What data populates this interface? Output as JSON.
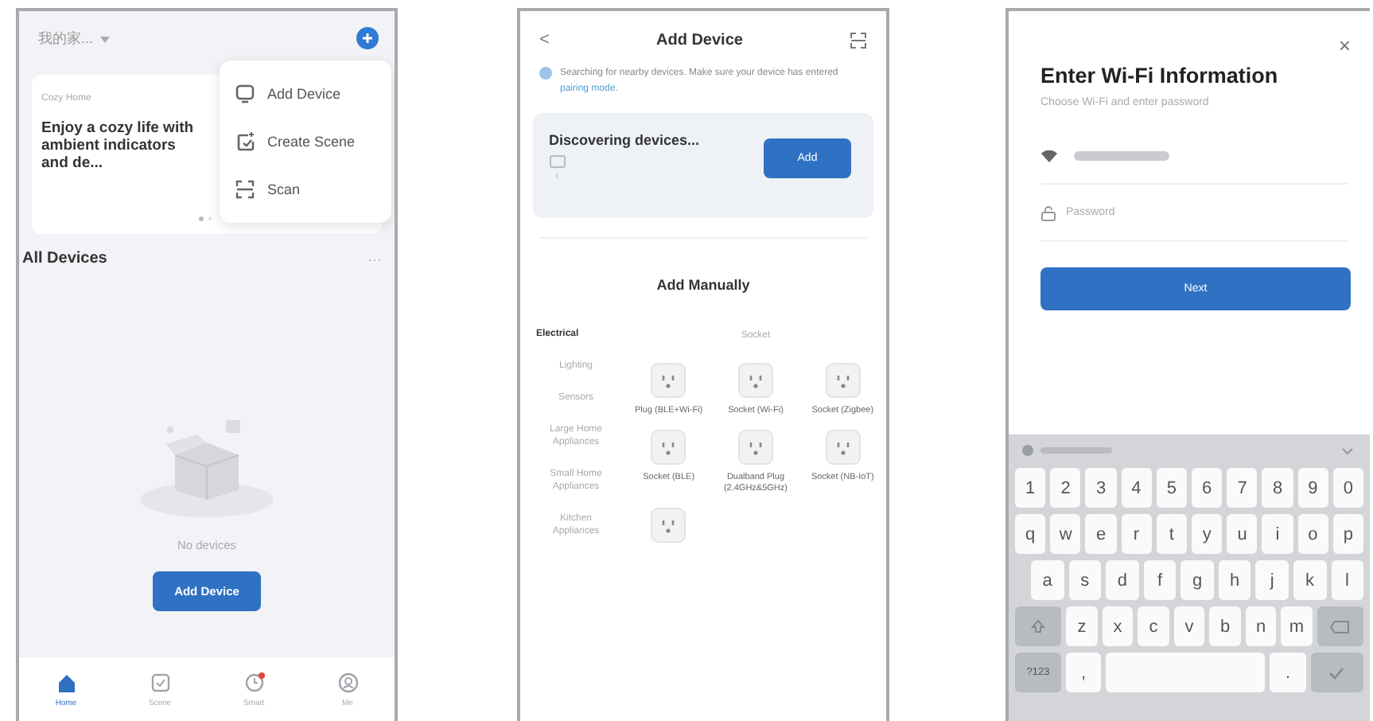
{
  "home_screen": {
    "home_name": "我的家...",
    "card": {
      "label": "Cozy Home",
      "text": "Enjoy a cozy life with ambient indicators and de..."
    },
    "menu": [
      {
        "kind": "add",
        "label": "Add Device"
      },
      {
        "kind": "scene",
        "label": "Create Scene"
      },
      {
        "kind": "scan",
        "label": "Scan"
      }
    ],
    "section_title": "All Devices",
    "more": "···",
    "empty_text": "No devices",
    "add_button": "Add Device",
    "tabs": [
      {
        "kind": "home",
        "label": "Home",
        "selected": true,
        "badge": false
      },
      {
        "kind": "scene",
        "label": "Scene",
        "selected": false,
        "badge": false
      },
      {
        "kind": "smart",
        "label": "Smart",
        "selected": false,
        "badge": true
      },
      {
        "kind": "me",
        "label": "Me",
        "selected": false,
        "badge": false
      }
    ]
  },
  "add_device_screen": {
    "back": "<",
    "title": "Add Device",
    "notice": "Searching for nearby devices. Make sure your device has entered ",
    "notice_link": "pairing mode",
    "notice_end": ".",
    "discovering": "Discovering devices...",
    "add_button": "Add",
    "section_title": "Add Manually",
    "categories": [
      {
        "label": "Electrical",
        "selected": true
      },
      {
        "label": "Lighting",
        "selected": false
      },
      {
        "label": "Sensors",
        "selected": false
      },
      {
        "label": "Large Home Appliances",
        "selected": false
      },
      {
        "label": "Small Home Appliances",
        "selected": false
      },
      {
        "label": "Kitchen Appliances",
        "selected": false
      }
    ],
    "group_title": "Socket",
    "devices": [
      {
        "kind": "socket",
        "name": "Plug (BLE+Wi-Fi)"
      },
      {
        "kind": "socket",
        "name": "Socket (Wi-Fi)"
      },
      {
        "kind": "socket",
        "name": "Socket (Zigbee)"
      },
      {
        "kind": "socket",
        "name": "Socket (BLE)"
      },
      {
        "kind": "socket",
        "name": "Dualband Plug (2.4GHz&5GHz)"
      },
      {
        "kind": "socket",
        "name": "Socket (NB-IoT)"
      },
      {
        "kind": "socket"
      }
    ]
  },
  "wifi_screen": {
    "close": "×",
    "title": "Enter Wi-Fi Information",
    "subtitle": "Choose Wi-Fi and enter password",
    "password_placeholder": "Password",
    "next_button": "Next",
    "keyboard": [
      [
        {
          "kind": "char",
          "label": "1"
        },
        {
          "kind": "char",
          "label": "2"
        },
        {
          "kind": "char",
          "label": "3"
        },
        {
          "kind": "char",
          "label": "4"
        },
        {
          "kind": "char",
          "label": "5"
        },
        {
          "kind": "char",
          "label": "6"
        },
        {
          "kind": "char",
          "label": "7"
        },
        {
          "kind": "char",
          "label": "8"
        },
        {
          "kind": "char",
          "label": "9"
        },
        {
          "kind": "char",
          "label": "0"
        }
      ],
      [
        {
          "kind": "char",
          "label": "q"
        },
        {
          "kind": "char",
          "label": "w"
        },
        {
          "kind": "char",
          "label": "e"
        },
        {
          "kind": "char",
          "label": "r"
        },
        {
          "kind": "char",
          "label": "t"
        },
        {
          "kind": "char",
          "label": "y"
        },
        {
          "kind": "char",
          "label": "u"
        },
        {
          "kind": "char",
          "label": "i"
        },
        {
          "kind": "char",
          "label": "o"
        },
        {
          "kind": "char",
          "label": "p"
        }
      ],
      [
        {
          "kind": "char",
          "label": "a"
        },
        {
          "kind": "char",
          "label": "s"
        },
        {
          "kind": "char",
          "label": "d"
        },
        {
          "kind": "char",
          "label": "f"
        },
        {
          "kind": "char",
          "label": "g"
        },
        {
          "kind": "char",
          "label": "h"
        },
        {
          "kind": "char",
          "label": "j"
        },
        {
          "kind": "char",
          "label": "k"
        },
        {
          "kind": "char",
          "label": "l"
        }
      ],
      [
        {
          "kind": "shift"
        },
        {
          "kind": "char",
          "label": "z"
        },
        {
          "kind": "char",
          "label": "x"
        },
        {
          "kind": "char",
          "label": "c"
        },
        {
          "kind": "char",
          "label": "v"
        },
        {
          "kind": "char",
          "label": "b"
        },
        {
          "kind": "char",
          "label": "n"
        },
        {
          "kind": "char",
          "label": "m"
        },
        {
          "kind": "backspace"
        }
      ],
      [
        {
          "kind": "mode",
          "label": "?123"
        },
        {
          "kind": "char",
          "label": ","
        },
        {
          "kind": "space"
        },
        {
          "kind": "char",
          "label": "."
        },
        {
          "kind": "enter"
        }
      ]
    ]
  }
}
